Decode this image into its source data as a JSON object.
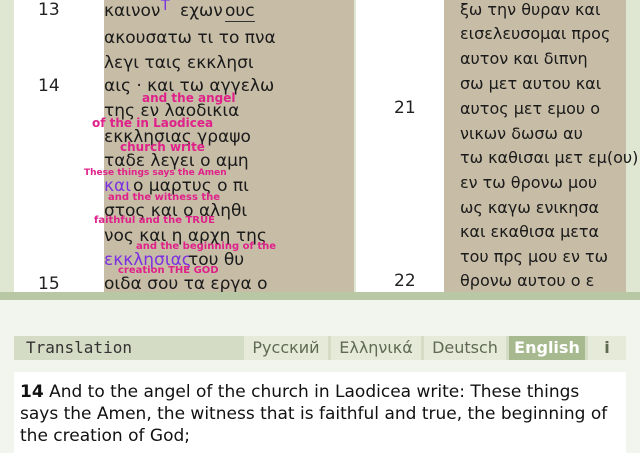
{
  "left_column": {
    "verse_numbers": {
      "v13": "13",
      "v14": "14",
      "v15": "15"
    },
    "lines": [
      {
        "text": "καινον"
      },
      {
        "text": "ακουσατω τι το πνα"
      },
      {
        "text": "λεγι ταις εκκλησι"
      },
      {
        "text": "αις · και τω αγγελω"
      },
      {
        "text": "της εν λαοδικια"
      },
      {
        "text": "εκκλησιας γραψο"
      },
      {
        "text": "ταδε λεγει ο αμη"
      },
      {
        "text": "ο μαρτυς ο πι"
      },
      {
        "text": "στος και ο αληθι"
      },
      {
        "text": "νος και η αρχη της"
      },
      {
        "text": "του θυ"
      },
      {
        "text": "οιδα σου τα εργα ο"
      }
    ],
    "inline": {
      "tau": "Τ",
      "exon": "εχων",
      "ouc": "ουc",
      "kai": "και",
      "ekklesias": "εκκλησιας"
    },
    "glosses": {
      "the_angel": "and  the    angel",
      "of_laodicea": "of the  in  Laodicea",
      "church_write": "church          write",
      "these_things": "These things    says      the      Amen",
      "witness": "and   the  witness  the",
      "faithful": "faithful     and  the   TRUE",
      "beginning": "and   the beginning  of the",
      "creation": "creation         THE    GOD"
    }
  },
  "right_column": {
    "verse_numbers": {
      "v21": "21",
      "v22": "22"
    },
    "lines": [
      {
        "text": "ξω την θυραν και"
      },
      {
        "text": "εισελευσομαι προς"
      },
      {
        "text": "αυτον και διπνη"
      },
      {
        "text": "σω μετ αυτου και"
      },
      {
        "text": "αυτος μετ εμου ο"
      },
      {
        "text": "νικων δωσω αυ"
      },
      {
        "text": "τω καθισαι μετ εμ(ου)"
      },
      {
        "text": "εν τω θρονω μου"
      },
      {
        "text": "ως καγω ενικησα"
      },
      {
        "text": "και εκαθισα μετα"
      },
      {
        "text": "του πρς μου εν τω"
      },
      {
        "text": "θρονω αυτου ο ε"
      }
    ]
  },
  "translation_panel": {
    "title": "Translation",
    "tabs": [
      {
        "label": "Русский"
      },
      {
        "label": "Ελληνικά"
      },
      {
        "label": "Deutsch"
      },
      {
        "label": "English",
        "active": true
      },
      {
        "label": "i"
      }
    ],
    "verse_number": "14",
    "verse_text": "And to the angel of the church in Laodicea write: These things says the Amen, the witness that is faithful and true, the beginning of the creation of God;"
  },
  "colors": {
    "parchment": "#c7bda7",
    "gloss": "#e0218a",
    "purple": "#7b2fe0",
    "tab_active": "#a7b98e"
  }
}
